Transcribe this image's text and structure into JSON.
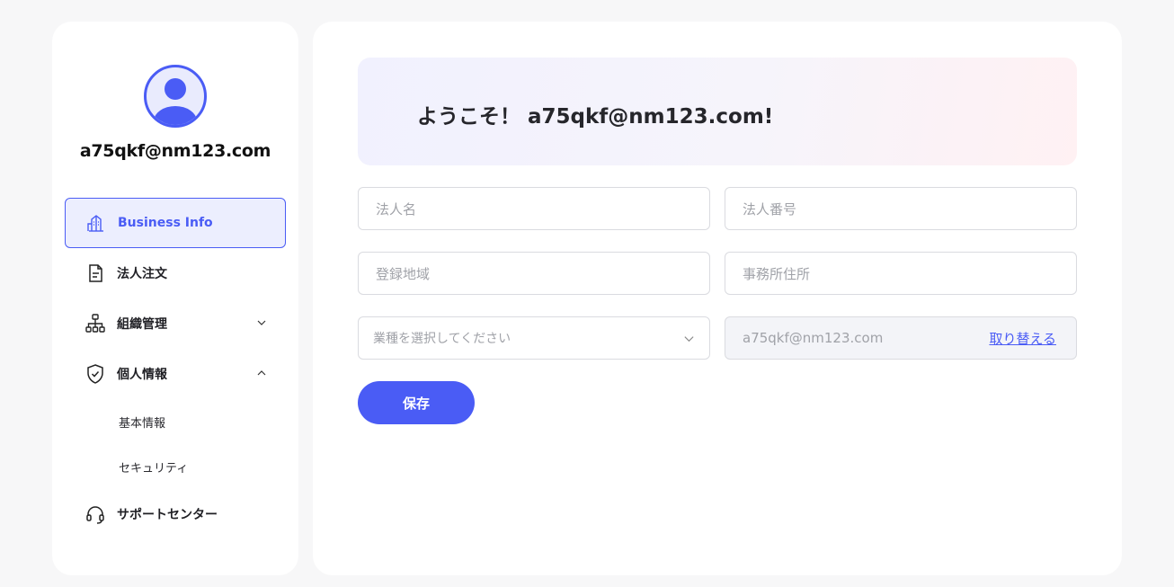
{
  "user": {
    "email": "a75qkf@nm123.com"
  },
  "sidebar": {
    "items": [
      {
        "label": "Business Info",
        "icon": "building-icon"
      },
      {
        "label": "法人注文",
        "icon": "document-icon"
      },
      {
        "label": "組織管理",
        "icon": "org-chart-icon"
      },
      {
        "label": "個人情報",
        "icon": "shield-check-icon"
      },
      {
        "label": "サポートセンター",
        "icon": "headset-icon"
      }
    ],
    "subitems": [
      {
        "label": "基本情報"
      },
      {
        "label": "セキュリティ"
      }
    ]
  },
  "banner": {
    "title": "ようこそ！ a75qkf@nm123.com!"
  },
  "form": {
    "corp_name_placeholder": "法人名",
    "corp_number_placeholder": "法人番号",
    "region_placeholder": "登録地域",
    "office_address_placeholder": "事務所住所",
    "industry_placeholder": "業種を選択してください",
    "email_value": "a75qkf@nm123.com",
    "swap_label": "取り替える",
    "save_label": "保存"
  },
  "colors": {
    "accent": "#4a5cf5",
    "background": "#f7f7f8",
    "card": "#ffffff"
  }
}
